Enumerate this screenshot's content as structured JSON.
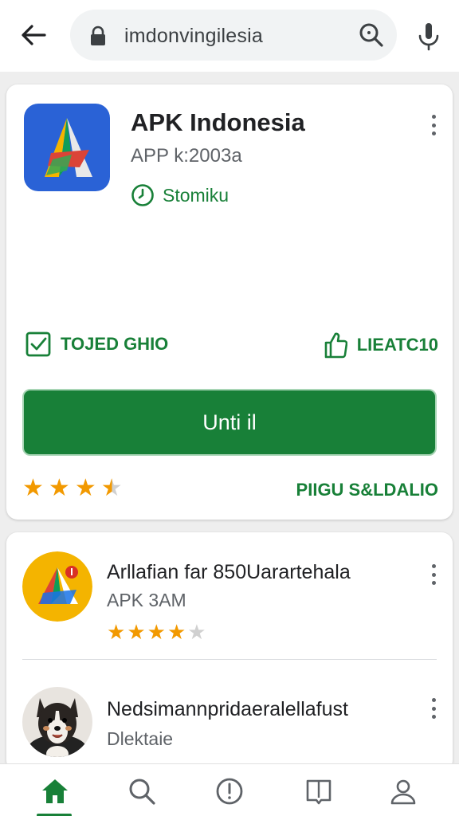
{
  "browser": {
    "url": "imdonvingilesia"
  },
  "app": {
    "title": "APK Indonesia",
    "subtitle": "APP k:2003a",
    "status": "Stomiku",
    "feature_left": "TOJED GHIO",
    "feature_right": "LIEATC10",
    "install_label": "Unti il",
    "rating_stars": 3.5,
    "rating_link": "PIIGU S&LDALIO"
  },
  "list": [
    {
      "title": "Arllafian far 850Uarartehala",
      "subtitle": "APK 3AM",
      "rating_stars": 4
    },
    {
      "title": "Nedsimannpridaeralellafust",
      "subtitle": "Dlektaie"
    }
  ],
  "colors": {
    "accent": "#188038",
    "star": "#f29900",
    "icon_bg": "#2a62d6"
  },
  "icons": {
    "back": "arrow-left-icon",
    "lock": "lock-icon",
    "search": "search-icon",
    "mic": "mic-icon",
    "status": "clock-icon",
    "feature_left": "checkbox-icon",
    "feature_right": "thumbs-up-icon",
    "nav": [
      "home-icon",
      "search-icon",
      "alert-icon",
      "book-icon",
      "profile-icon"
    ]
  }
}
